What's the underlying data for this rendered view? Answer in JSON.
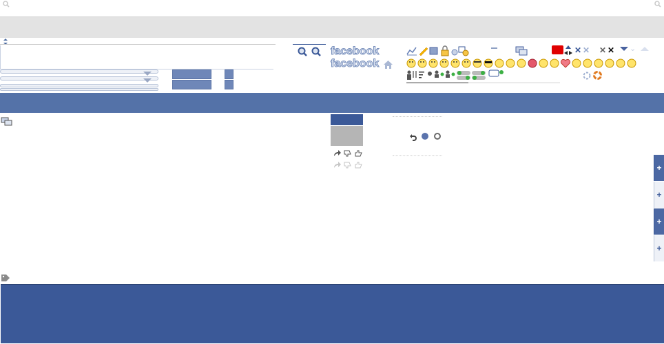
{
  "colors": {
    "facebook_blue": "#3b5998",
    "bar_blue": "#5472a8",
    "footer_blue": "#3b5998",
    "grey_band": "#e3e3e3",
    "red_badge": "#e00000"
  },
  "icons": {
    "search_left": "search-icon",
    "search_right": "search-icon",
    "sort": "sort-arrows-icon",
    "zoom_in": "magnifier-plus-icon",
    "zoom_out": "magnifier-minus-icon",
    "home": "home-icon",
    "chat": "chat-bubbles-icon",
    "tag": "tag-icon",
    "share": "share-arrow-icon",
    "dislike": "thumb-down-icon",
    "like": "thumb-up-icon",
    "undo": "undo-arrow-icon",
    "plus": "plus-icon"
  },
  "logos": [
    "facebook",
    "facebook"
  ],
  "sprite_row_1": [
    "chart-icon",
    "pencil-icon",
    "save-icon",
    "lock-icon",
    "gear-icon",
    "copy-icon",
    "clock-icon",
    "minus-icon",
    "chat-icon",
    "red-flag-icon",
    "resize-icon",
    "close-icon",
    "close-icon",
    "close-icon",
    "close-icon",
    "triangle-down-icon",
    "chevron-down-icon",
    "triangle-up-icon"
  ],
  "emoji_row": [
    "smile",
    "frown",
    "grin",
    "big-grin",
    "gasp",
    "wink",
    "glasses",
    "sunglasses",
    "grumpy",
    "unsure",
    "cry",
    "devil",
    "angel",
    "kiss",
    "heart",
    "kiki",
    "squint",
    "confused",
    "upset",
    "tongue",
    "curly-lips"
  ],
  "sprite_row_3": [
    "user-icon",
    "sort-icon",
    "filter-icon",
    "gear-icon",
    "user-icon",
    "online-dot",
    "user-icon",
    "online-dot",
    "toggle-icon",
    "toggle-icon",
    "chat-online-icon"
  ],
  "side_tabs": [
    "+",
    "+",
    "+",
    "+"
  ],
  "radio_selected": 1
}
